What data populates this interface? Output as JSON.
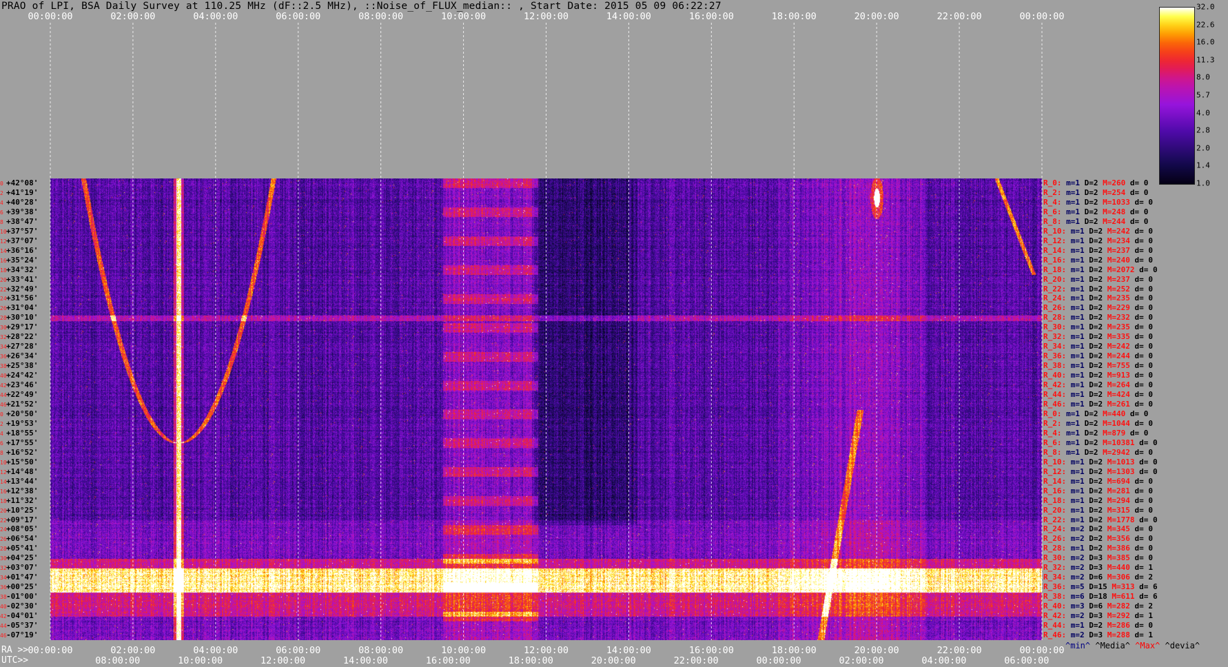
{
  "title": "PRAO of LPI, BSA Daily Survey at 110.25 MHz (dF::2.5 MHz), ::Noise_of_FLUX_median:: , Start Date: 2015 05 09 06:22:27",
  "top_axis": [
    "00:00:00",
    "02:00:00",
    "04:00:00",
    "06:00:00",
    "08:00:00",
    "10:00:00",
    "12:00:00",
    "14:00:00",
    "16:00:00",
    "18:00:00",
    "20:00:00",
    "22:00:00",
    "00:00:00"
  ],
  "bottom_axis_ra_label": "RA >>",
  "bottom_axis_ra": [
    "00:00:00",
    "02:00:00",
    "04:00:00",
    "06:00:00",
    "08:00:00",
    "10:00:00",
    "12:00:00",
    "14:00:00",
    "16:00:00",
    "18:00:00",
    "20:00:00",
    "22:00:00",
    "00:00:00"
  ],
  "bottom_axis_utc_label": "UTC>>",
  "bottom_axis_utc": [
    "08:00:00",
    "10:00:00",
    "12:00:00",
    "14:00:00",
    "16:00:00",
    "18:00:00",
    "20:00:00",
    "22:00:00",
    "00:00:00",
    "02:00:00",
    "04:00:00",
    "06:00:00"
  ],
  "declinations": [
    {
      "i": "0",
      "d": "+42°08'"
    },
    {
      "i": "2",
      "d": "+41°19'"
    },
    {
      "i": "4",
      "d": "+40°28'"
    },
    {
      "i": "6",
      "d": "+39°38'"
    },
    {
      "i": "8",
      "d": "+38°47'"
    },
    {
      "i": "10",
      "d": "+37°57'"
    },
    {
      "i": "12",
      "d": "+37°07'"
    },
    {
      "i": "14",
      "d": "+36°16'"
    },
    {
      "i": "16",
      "d": "+35°24'"
    },
    {
      "i": "18",
      "d": "+34°32'"
    },
    {
      "i": "20",
      "d": "+33°41'"
    },
    {
      "i": "22",
      "d": "+32°49'"
    },
    {
      "i": "24",
      "d": "+31°56'"
    },
    {
      "i": "26",
      "d": "+31°04'"
    },
    {
      "i": "28",
      "d": "+30°10'"
    },
    {
      "i": "30",
      "d": "+29°17'"
    },
    {
      "i": "32",
      "d": "+28°22'"
    },
    {
      "i": "34",
      "d": "+27°28'"
    },
    {
      "i": "36",
      "d": "+26°34'"
    },
    {
      "i": "38",
      "d": "+25°38'"
    },
    {
      "i": "40",
      "d": "+24°42'"
    },
    {
      "i": "42",
      "d": "+23°46'"
    },
    {
      "i": "44",
      "d": "+22°49'"
    },
    {
      "i": "46",
      "d": "+21°52'"
    },
    {
      "i": "0",
      "d": "+20°50'"
    },
    {
      "i": "2",
      "d": "+19°53'"
    },
    {
      "i": "4",
      "d": "+18°55'"
    },
    {
      "i": "6",
      "d": "+17°55'"
    },
    {
      "i": "8",
      "d": "+16°52'"
    },
    {
      "i": "10",
      "d": "+15°50'"
    },
    {
      "i": "12",
      "d": "+14°48'"
    },
    {
      "i": "14",
      "d": "+13°44'"
    },
    {
      "i": "16",
      "d": "+12°38'"
    },
    {
      "i": "18",
      "d": "+11°32'"
    },
    {
      "i": "20",
      "d": "+10°25'"
    },
    {
      "i": "22",
      "d": "+09°17'"
    },
    {
      "i": "24",
      "d": "+08°05'"
    },
    {
      "i": "26",
      "d": "+06°54'"
    },
    {
      "i": "28",
      "d": "+05°41'"
    },
    {
      "i": "30",
      "d": "+04°25'"
    },
    {
      "i": "32",
      "d": "+03°07'"
    },
    {
      "i": "34",
      "d": "+01°47'"
    },
    {
      "i": "36",
      "d": "+00°25'"
    },
    {
      "i": "38",
      "d": "-01°00'"
    },
    {
      "i": "40",
      "d": "-02°30'"
    },
    {
      "i": "42",
      "d": "-04°01'"
    },
    {
      "i": "44",
      "d": "-05°37'"
    },
    {
      "i": "46",
      "d": "-07°19'"
    }
  ],
  "stats": [
    {
      "r": "R_0:",
      "m": "m=1",
      "d": "D=2",
      "M": "M=260",
      "dd": "d= 0"
    },
    {
      "r": "R_2:",
      "m": "m=1",
      "d": "D=2",
      "M": "M=254",
      "dd": "d= 0"
    },
    {
      "r": "R_4:",
      "m": "m=1",
      "d": "D=2",
      "M": "M=1033",
      "dd": "d= 0"
    },
    {
      "r": "R_6:",
      "m": "m=1",
      "d": "D=2",
      "M": "M=248",
      "dd": "d= 0"
    },
    {
      "r": "R_8:",
      "m": "m=1",
      "d": "D=2",
      "M": "M=244",
      "dd": "d= 0"
    },
    {
      "r": "R_10:",
      "m": "m=1",
      "d": "D=2",
      "M": "M=242",
      "dd": "d= 0"
    },
    {
      "r": "R_12:",
      "m": "m=1",
      "d": "D=2",
      "M": "M=234",
      "dd": "d= 0"
    },
    {
      "r": "R_14:",
      "m": "m=1",
      "d": "D=2",
      "M": "M=237",
      "dd": "d= 0"
    },
    {
      "r": "R_16:",
      "m": "m=1",
      "d": "D=2",
      "M": "M=240",
      "dd": "d= 0"
    },
    {
      "r": "R_18:",
      "m": "m=1",
      "d": "D=2",
      "M": "M=2072",
      "dd": "d= 0"
    },
    {
      "r": "R_20:",
      "m": "m=1",
      "d": "D=2",
      "M": "M=237",
      "dd": "d= 0"
    },
    {
      "r": "R_22:",
      "m": "m=1",
      "d": "D=2",
      "M": "M=252",
      "dd": "d= 0"
    },
    {
      "r": "R_24:",
      "m": "m=1",
      "d": "D=2",
      "M": "M=235",
      "dd": "d= 0"
    },
    {
      "r": "R_26:",
      "m": "m=1",
      "d": "D=2",
      "M": "M=229",
      "dd": "d= 0"
    },
    {
      "r": "R_28:",
      "m": "m=1",
      "d": "D=2",
      "M": "M=232",
      "dd": "d= 0"
    },
    {
      "r": "R_30:",
      "m": "m=1",
      "d": "D=2",
      "M": "M=235",
      "dd": "d= 0"
    },
    {
      "r": "R_32:",
      "m": "m=1",
      "d": "D=2",
      "M": "M=335",
      "dd": "d= 0"
    },
    {
      "r": "R_34:",
      "m": "m=1",
      "d": "D=2",
      "M": "M=242",
      "dd": "d= 0"
    },
    {
      "r": "R_36:",
      "m": "m=1",
      "d": "D=2",
      "M": "M=244",
      "dd": "d= 0"
    },
    {
      "r": "R_38:",
      "m": "m=1",
      "d": "D=2",
      "M": "M=755",
      "dd": "d= 0"
    },
    {
      "r": "R_40:",
      "m": "m=1",
      "d": "D=2",
      "M": "M=913",
      "dd": "d= 0"
    },
    {
      "r": "R_42:",
      "m": "m=1",
      "d": "D=2",
      "M": "M=264",
      "dd": "d= 0"
    },
    {
      "r": "R_44:",
      "m": "m=1",
      "d": "D=2",
      "M": "M=424",
      "dd": "d= 0"
    },
    {
      "r": "R_46:",
      "m": "m=1",
      "d": "D=2",
      "M": "M=261",
      "dd": "d= 0"
    },
    {
      "r": "R_0:",
      "m": "m=1",
      "d": "D=2",
      "M": "M=440",
      "dd": "d= 0"
    },
    {
      "r": "R_2:",
      "m": "m=1",
      "d": "D=2",
      "M": "M=1044",
      "dd": "d= 0"
    },
    {
      "r": "R_4:",
      "m": "m=1",
      "d": "D=2",
      "M": "M=879",
      "dd": "d= 0"
    },
    {
      "r": "R_6:",
      "m": "m=1",
      "d": "D=2",
      "M": "M=10381",
      "dd": "d= 0"
    },
    {
      "r": "R_8:",
      "m": "m=1",
      "d": "D=2",
      "M": "M=2942",
      "dd": "d= 0"
    },
    {
      "r": "R_10:",
      "m": "m=1",
      "d": "D=2",
      "M": "M=1013",
      "dd": "d= 0"
    },
    {
      "r": "R_12:",
      "m": "m=1",
      "d": "D=2",
      "M": "M=1303",
      "dd": "d= 0"
    },
    {
      "r": "R_14:",
      "m": "m=1",
      "d": "D=2",
      "M": "M=694",
      "dd": "d= 0"
    },
    {
      "r": "R_16:",
      "m": "m=1",
      "d": "D=2",
      "M": "M=281",
      "dd": "d= 0"
    },
    {
      "r": "R_18:",
      "m": "m=1",
      "d": "D=2",
      "M": "M=294",
      "dd": "d= 0"
    },
    {
      "r": "R_20:",
      "m": "m=1",
      "d": "D=2",
      "M": "M=315",
      "dd": "d= 0"
    },
    {
      "r": "R_22:",
      "m": "m=1",
      "d": "D=2",
      "M": "M=1778",
      "dd": "d= 0"
    },
    {
      "r": "R_24:",
      "m": "m=2",
      "d": "D=2",
      "M": "M=345",
      "dd": "d= 0"
    },
    {
      "r": "R_26:",
      "m": "m=2",
      "d": "D=2",
      "M": "M=356",
      "dd": "d= 0"
    },
    {
      "r": "R_28:",
      "m": "m=1",
      "d": "D=2",
      "M": "M=386",
      "dd": "d= 0"
    },
    {
      "r": "R_30:",
      "m": "m=2",
      "d": "D=3",
      "M": "M=385",
      "dd": "d= 0"
    },
    {
      "r": "R_32:",
      "m": "m=2",
      "d": "D=3",
      "M": "M=440",
      "dd": "d= 1"
    },
    {
      "r": "R_34:",
      "m": "m=2",
      "d": "D=6",
      "M": "M=306",
      "dd": "d= 2"
    },
    {
      "r": "R_36:",
      "m": "m=5",
      "d": "D=15",
      "M": "M=313",
      "dd": "d= 6"
    },
    {
      "r": "R_38:",
      "m": "m=6",
      "d": "D=18",
      "M": "M=611",
      "dd": "d= 6"
    },
    {
      "r": "R_40:",
      "m": "m=3",
      "d": "D=6",
      "M": "M=282",
      "dd": "d= 2"
    },
    {
      "r": "R_42:",
      "m": "m=2",
      "d": "D=3",
      "M": "M=292",
      "dd": "d= 1"
    },
    {
      "r": "R_44:",
      "m": "m=1",
      "d": "D=2",
      "M": "M=286",
      "dd": "d= 0"
    },
    {
      "r": "R_46:",
      "m": "m=2",
      "d": "D=3",
      "M": "M=288",
      "dd": "d= 1"
    }
  ],
  "legend": {
    "min": "^min^",
    "median": "^Media^",
    "max": "^Max^",
    "devia": "^devia^"
  },
  "colors": {
    "background": "#a0a0a0",
    "min": "#000080",
    "median": "#000000",
    "max": "#ff0000",
    "devia": "#000000"
  },
  "chart_data": {
    "type": "heatmap",
    "title": "PRAO of LPI, BSA Daily Survey at 110.25 MHz (dF::2.5 MHz), ::Noise_of_FLUX_median:: , Start Date: 2015 05 09 06:22:27",
    "x_axis": "RA 00:00:00 → 00:00:00 (24 h); UTC 06:22:27 → 06:22:27",
    "y_axis": "Declination +42°08' → -07°19' (48 beams)",
    "colorbar": {
      "ticks": [
        32.0,
        22.6,
        16.0,
        11.3,
        8.0,
        5.7,
        4.0,
        2.8,
        2.0,
        1.4,
        1.0
      ],
      "scale": "log",
      "colormap": "black-purple-red-yellow-white"
    },
    "features": [
      {
        "name": "Cas A transit (vertical source + parabolic arc)",
        "ra_hours": 3.1,
        "dec_range": "+42°08' to -07°19'"
      },
      {
        "name": "Cyg A bright spot",
        "ra_hours": 20.0,
        "dec": "+40°28'"
      },
      {
        "name": "Galactic plane band",
        "dec_rows": [
          "+00°25'",
          "-01°00'"
        ]
      },
      {
        "name": "Broadband interference column",
        "ra_hours": [
          9.8,
          11.5
        ]
      },
      {
        "name": "Diffuse galactic emission ramp",
        "ra_hours": [
          17.5,
          21.0
        ]
      }
    ]
  }
}
